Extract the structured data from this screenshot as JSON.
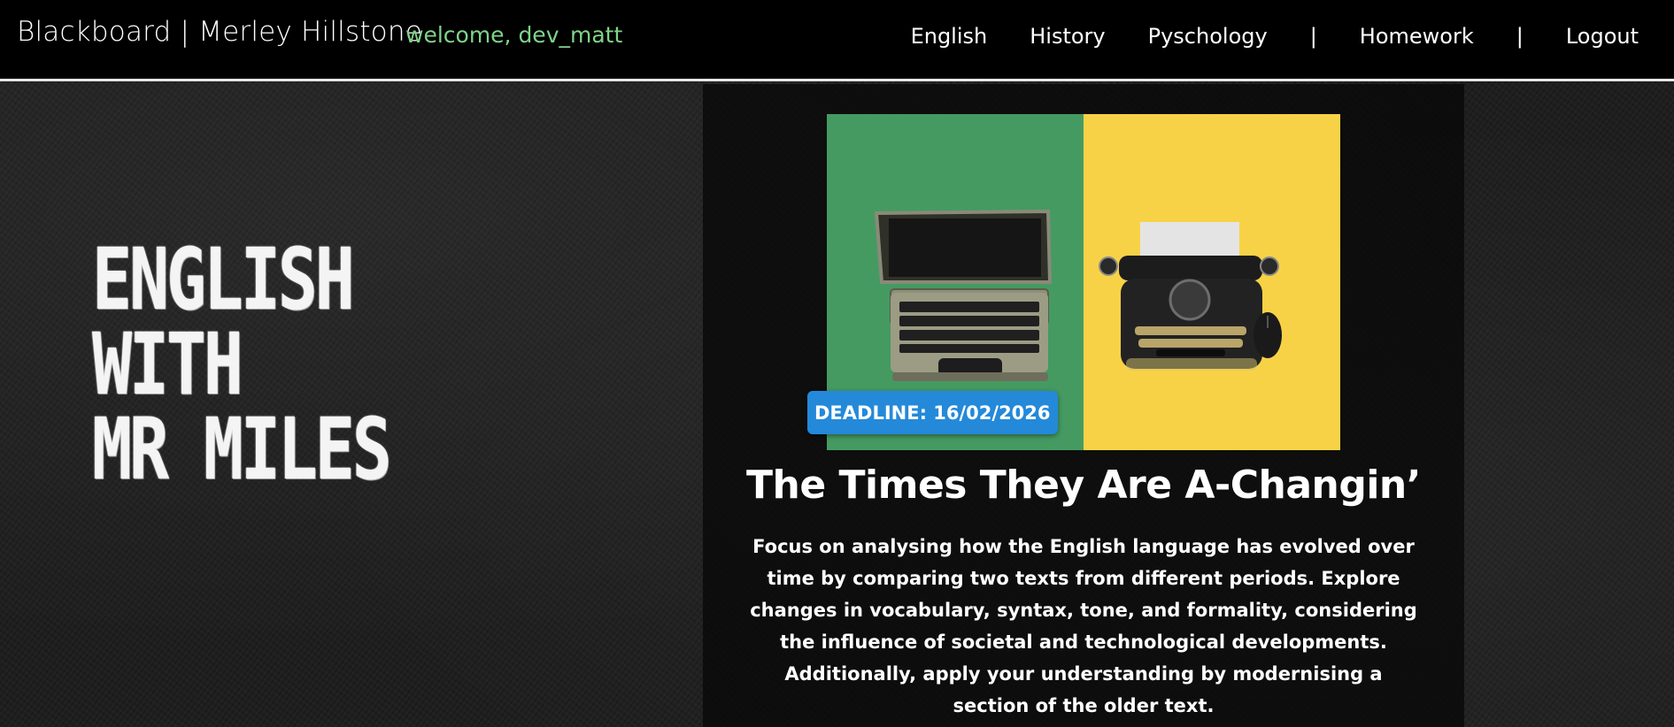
{
  "header": {
    "brand": "Blackboard | Merley Hillstone",
    "welcome": "welcome, dev_matt",
    "nav": {
      "english": "English",
      "history": "History",
      "psychology": "Pyschology",
      "sep1": "|",
      "homework": "Homework",
      "sep2": "|",
      "logout": "Logout"
    }
  },
  "hero": {
    "line1": "ENGLISH",
    "line2": "WITH",
    "line3": "MR MILES"
  },
  "assignment": {
    "deadline": "DEADLINE: 16/02/2026",
    "title": "The Times They Are A-Changin’",
    "description": "Focus on analysing how the English language has evolved over time by comparing two texts from different periods. Explore changes in vocabulary, syntax, tone, and formality, considering the influence of societal and technological developments. Additionally, apply your understanding by modernising a section of the older text."
  },
  "colors": {
    "nav_bg": "#000000",
    "welcome": "#7fd48a",
    "badge": "#2489d9",
    "image_left": "#459a62",
    "image_right": "#f8d246"
  }
}
